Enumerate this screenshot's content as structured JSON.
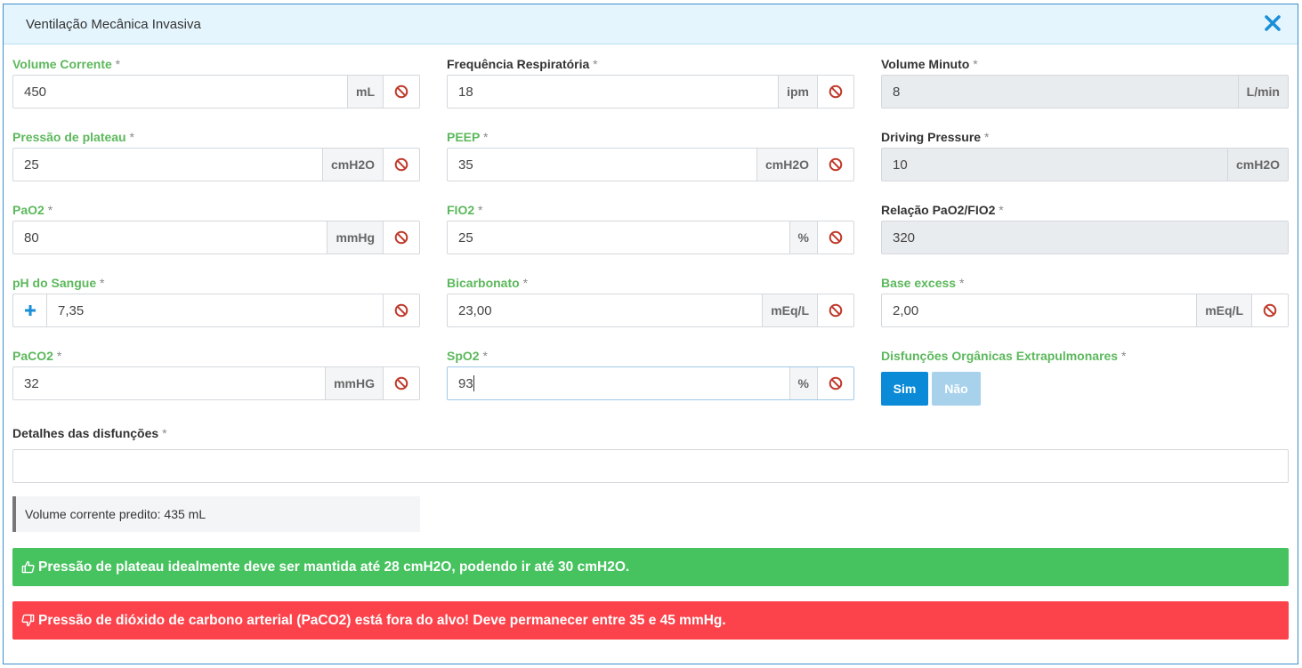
{
  "window": {
    "title": "Ventilação Mecânica Invasiva"
  },
  "required_mark": "*",
  "fields": {
    "volume_corrente": {
      "label": "Volume Corrente",
      "value": "450",
      "unit": "mL"
    },
    "frequencia": {
      "label": "Frequência Respiratória",
      "value": "18",
      "unit": "ipm"
    },
    "volume_minuto": {
      "label": "Volume Minuto",
      "value": "8",
      "unit": "L/min"
    },
    "pressao_plateau": {
      "label": "Pressão de plateau",
      "value": "25",
      "unit": "cmH2O"
    },
    "peep": {
      "label": "PEEP",
      "value": "35",
      "unit": "cmH2O"
    },
    "driving_pressure": {
      "label": "Driving Pressure",
      "value": "10",
      "unit": "cmH2O"
    },
    "pao2": {
      "label": "PaO2",
      "value": "80",
      "unit": "mmHg"
    },
    "fio2": {
      "label": "FIO2",
      "value": "25",
      "unit": "%"
    },
    "relacao": {
      "label": "Relação PaO2/FIO2",
      "value": "320"
    },
    "ph": {
      "label": "pH do Sangue",
      "value": "7,35"
    },
    "bicarbonato": {
      "label": "Bicarbonato",
      "value": "23,00",
      "unit": "mEq/L"
    },
    "base_excess": {
      "label": "Base excess",
      "value": "2,00",
      "unit": "mEq/L"
    },
    "paco2": {
      "label": "PaCO2",
      "value": "32",
      "unit": "mmHG"
    },
    "spo2": {
      "label": "SpO2",
      "value": "93",
      "unit": "%"
    },
    "disfuncoes": {
      "label": "Disfunções Orgânicas Extrapulmonares",
      "yes": "Sim",
      "no": "Não"
    },
    "detalhes": {
      "label": "Detalhes das disfunções",
      "value": ""
    }
  },
  "info": {
    "label": "Volume corrente predito:",
    "value": "435 mL"
  },
  "alerts": {
    "success": "Pressão de plateau idealmente deve ser mantida até 28 cmH2O, podendo ir até 30 cmH2O.",
    "danger": "Pressão de dióxido de carbono arterial (PaCO2) está fora do alvo! Deve permanecer entre 35 e 45 mmHg."
  },
  "colors": {
    "green_label": "#5cb85c",
    "success": "#46c35f",
    "danger": "#fc424a",
    "primary": "#0b8ad8",
    "primary_light": "#a8d2ec",
    "clear_icon": "#c0392b"
  }
}
